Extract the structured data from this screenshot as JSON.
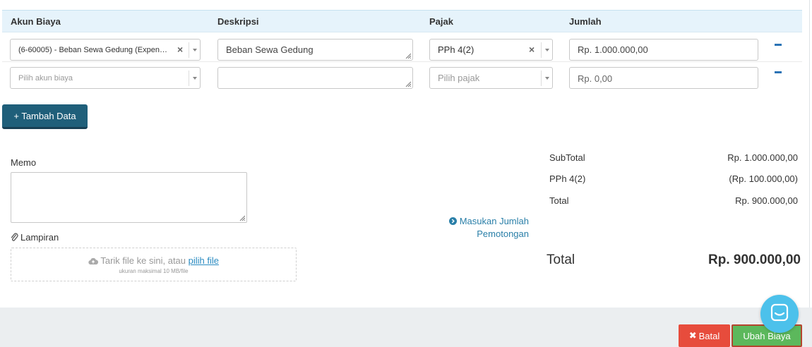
{
  "table": {
    "headers": {
      "account": "Akun Biaya",
      "description": "Deskripsi",
      "tax": "Pajak",
      "amount": "Jumlah"
    },
    "rows": [
      {
        "account": "(6-60005) - Beban Sewa Gedung (Expen…",
        "description": "Beban Sewa Gedung",
        "tax": "PPh 4(2)",
        "amount": "Rp. 1.000.000,00"
      },
      {
        "account_placeholder": "Pilih akun biaya",
        "description": "",
        "tax_placeholder": "Pilih pajak",
        "amount": "Rp. 0,00"
      }
    ]
  },
  "add_button": "+ Tambah Data",
  "memo": {
    "label": "Memo",
    "value": ""
  },
  "attachment": {
    "label": "Lampiran",
    "drop_text": "Tarik file ke sini, atau",
    "pick_link": "pilih file",
    "size_note": "ukuran maksimal 10 MB/file"
  },
  "deduction_link": {
    "line1": "Masukan Jumlah",
    "line2": "Pemotongan"
  },
  "summary": {
    "subtotal_label": "SubTotal",
    "subtotal_value": "Rp. 1.000.000,00",
    "tax_label": "PPh 4(2)",
    "tax_value": "(Rp. 100.000,00)",
    "total_label": "Total",
    "total_value": "Rp. 900.000,00",
    "grand_total_label": "Total",
    "grand_total_value": "Rp. 900.000,00"
  },
  "footer": {
    "cancel_label": "Batal",
    "submit_label": "Ubah Biaya"
  },
  "colors": {
    "header_bg": "#e6f3fb",
    "primary_button": "#1f5f7a",
    "cancel_button": "#e74c3c",
    "submit_button": "#5cb85c",
    "link": "#2a8bc1",
    "chat_bubble": "#4cc1eb"
  }
}
